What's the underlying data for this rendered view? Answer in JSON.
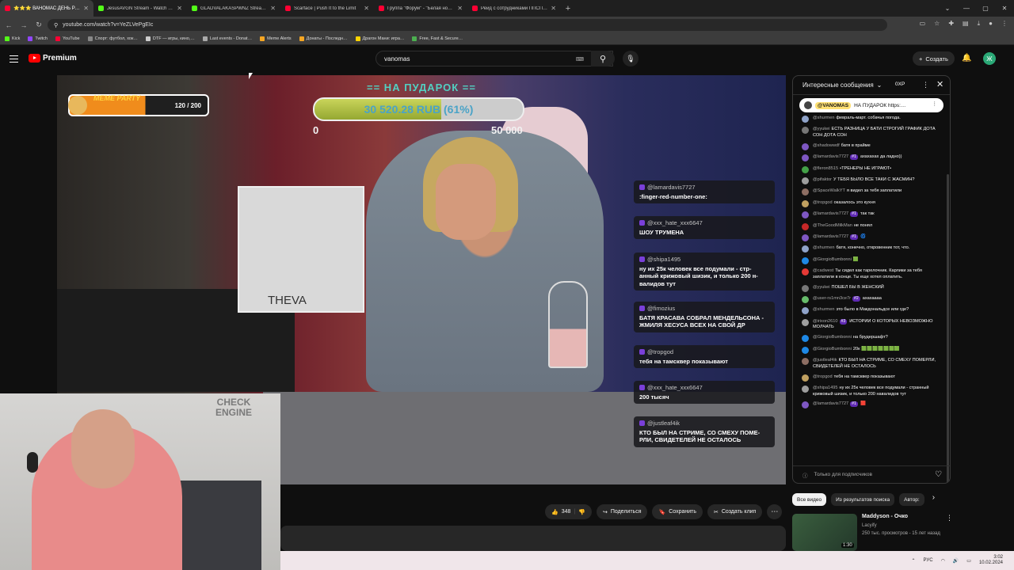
{
  "browser": {
    "tabs": [
      {
        "title": "⭐⭐⭐ ВАНОМАС ДЕНЬ РО…",
        "color": "#ff0033",
        "active": true
      },
      {
        "title": "JesusAVGN Stream - Watch Liv…",
        "color": "#53fc18",
        "active": false
      },
      {
        "title": "GLADVALAKASPWNZ Stream -…",
        "color": "#53fc18",
        "active": false
      },
      {
        "title": "Scarface | Push It to the Limit",
        "color": "#ff0033",
        "active": false
      },
      {
        "title": "Группа \"Форум\" - \"Белая ноч…",
        "color": "#ff0033",
        "active": false
      },
      {
        "title": "Рейд с сотрудниками ППСП Н…",
        "color": "#ff0033",
        "active": false
      }
    ],
    "url": "youtube.com/watch?v=YeZLVePgEIc",
    "bookmarks": [
      {
        "label": "Kick",
        "color": "#53fc18"
      },
      {
        "label": "Twitch",
        "color": "#9146ff"
      },
      {
        "label": "YouTube",
        "color": "#ff0033"
      },
      {
        "label": "Спорт: футбол, хок…",
        "color": "#888888"
      },
      {
        "label": "DTF — игры, кино,…",
        "color": "#cccccc"
      },
      {
        "label": "Last events - Donat…",
        "color": "#aaaaaa"
      },
      {
        "label": "Meme Alerts",
        "color": "#f5a623"
      },
      {
        "label": "Донаты - Последн…",
        "color": "#f5a623"
      },
      {
        "label": "Драгон Мани: игра…",
        "color": "#ffd400"
      },
      {
        "label": "Free, Fast & Secure…",
        "color": "#4caf50"
      }
    ]
  },
  "youtube": {
    "logo": "Premium",
    "search_value": "vanomas",
    "create_label": "Создать",
    "avatar_letter": "Ж"
  },
  "stream": {
    "donation_title": "== НА ПУДАРОК ==",
    "donation_amount": "30 520.28 RUB (61%)",
    "donation_progress": 0.61,
    "donation_min": "0",
    "donation_max": "50 000",
    "meme_title": "MEME PARTY",
    "meme_count": "120 / 200",
    "pc_label": "THEVA",
    "cam_sign": "CHECK ENGINE",
    "overlay_msgs": [
      {
        "user": "@lamardavis7727",
        "text": ":finger-red-number-one:"
      },
      {
        "user": "@xxx_hate_xxx6647",
        "text": "ШОУ ТРУМЕНА"
      },
      {
        "user": "@shipa1495",
        "text": "ну их 25к человек все подумали - стр-анный крижовый шизик, и только 200 н-валидов тут"
      },
      {
        "user": "@fimozius",
        "text": "БАТЯ КРАСАВА СОБРАЛ МЕНДЕЛЬСОНА - ЖМИЛЯ ХЕСУСА ВСЕХ НА СВОЙ ДР"
      },
      {
        "user": "@tropgod",
        "text": "тебя на тамсквер показывают"
      },
      {
        "user": "@xxx_hate_xxx6647",
        "text": "200 тысяч"
      },
      {
        "user": "@justleaf4ik",
        "text": "КТО БЫЛ НА СТРИМЕ, СО СМЕХУ ПОМЕ-РЛИ, СВИДЕТЕЛЕЙ НЕ ОСТАЛОСЬ"
      }
    ]
  },
  "actions": {
    "likes": "348",
    "share": "Поделиться",
    "save": "Сохранить",
    "clip": "Создать клип"
  },
  "chat": {
    "title": "Интересные сообщения",
    "xp": "0XP",
    "pinned_user": "@VANOMAS",
    "pinned_text": "НА ПУДАРОК https:…",
    "messages": [
      {
        "user": "@shurmen",
        "badge": "",
        "text": "февраль-март. собачья погода.",
        "color": "#8fa3c9"
      },
      {
        "user": "@yyukei",
        "badge": "",
        "text": "ЕСТЬ РАЗНИЦА У БАТИ СТРОГИЙ ГРАФИК ДОТА СОН ДОТА СОН",
        "color": "#777777"
      },
      {
        "user": "@shadowwdf",
        "badge": "",
        "text": "батя в прайме",
        "color": "#7e57c2"
      },
      {
        "user": "@lamardavis7727",
        "badge": "#1",
        "text": "ахахахах да ладно))",
        "color": "#7e57c2"
      },
      {
        "user": "@fleron8515",
        "badge": "",
        "text": "•ТРЕНЕРЫ НЕ ИГРАЮТ•",
        "color": "#43a047"
      },
      {
        "user": "@pifaktor",
        "badge": "",
        "text": "У ТЕБЯ БЫЛО ВСЕ ТАКИ С ЖАСМИН?",
        "color": "#9e9e9e"
      },
      {
        "user": "@SpaceWalkYT",
        "badge": "",
        "text": "я видел за тебя заплатили",
        "color": "#8d6e63"
      },
      {
        "user": "@tropgod",
        "badge": "",
        "text": "оказалось это кухня",
        "color": "#c0a060"
      },
      {
        "user": "@lamardavis7727",
        "badge": "#1",
        "text": "так так",
        "color": "#7e57c2"
      },
      {
        "user": "@TheGoodMilkMan",
        "badge": "",
        "text": "не понял",
        "color": "#c62828"
      },
      {
        "user": "@lamardavis7727",
        "badge": "#1",
        "text": "🌀",
        "color": "#7e57c2"
      },
      {
        "user": "@shurmen",
        "badge": "",
        "text": "батя, конечно, откровенник тот, что.",
        "color": "#8fa3c9"
      },
      {
        "user": "@GiorgioBumbonni",
        "badge": "",
        "text": "🟩",
        "color": "#1e88e5"
      },
      {
        "user": "@cadwest",
        "badge": "",
        "text": "Ты сидел как тарелочник. Карлики за тебя заплатили в конце. Ты еще хотел оплатить.",
        "color": "#e53935"
      },
      {
        "user": "@yyukei",
        "badge": "",
        "text": "ПОШЕЛ БЫ В ЖЕНСКИЙ",
        "color": "#777777"
      },
      {
        "user": "@user-rs1mn3ce7r",
        "badge": "#2",
        "text": "ахахаааа",
        "color": "#66bb6a"
      },
      {
        "user": "@shurmen",
        "badge": "",
        "text": "это было в Макдональдсе или где?",
        "color": "#8fa3c9"
      },
      {
        "user": "@irixon2610",
        "badge": "#3",
        "text": "ИСТОРИИ О КОТОРЫХ НЕВОЗМОЖНО МОЛЧАТЬ",
        "color": "#9e9e9e"
      },
      {
        "user": "@GiorgioBumbonni",
        "badge": "",
        "text": "на брудершафт?",
        "color": "#1e88e5"
      },
      {
        "user": "@GiorgioBumbonni",
        "badge": "",
        "text": "20к 🟩🟩🟩🟩🟩🟩🟩",
        "color": "#1e88e5"
      },
      {
        "user": "@justleaf4ik",
        "badge": "",
        "text": "КТО БЫЛ НА СТРИМЕ, СО СМЕХУ ПОМЕРЛИ, СВИДЕТЕЛЕЙ НЕ ОСТАЛОСЬ",
        "color": "#8d6e63"
      },
      {
        "user": "@tropgod",
        "badge": "",
        "text": "тебя на тамсквер показывают",
        "color": "#c0a060"
      },
      {
        "user": "@shipa1495",
        "badge": "",
        "text": "ну их 25к человек все подумали - странный крижовый шизик, и только 200 навалидов тут",
        "color": "#9e9e9e"
      },
      {
        "user": "@lamardavis7727",
        "badge": "#1",
        "text": "🟥",
        "color": "#7e57c2"
      }
    ],
    "footer": "Только для подписчиков"
  },
  "chips": [
    "Все видео",
    "Из результатов поиска",
    "Автор: "
  ],
  "recommended": {
    "title": "Maddyson - Очко",
    "channel": "Lacyify",
    "views": "250 тыс. просмотров - 15 лет назад",
    "duration": "1:30"
  },
  "taskbar": {
    "lang": "РУС",
    "time": "3:02",
    "date": "10.02.2024"
  }
}
